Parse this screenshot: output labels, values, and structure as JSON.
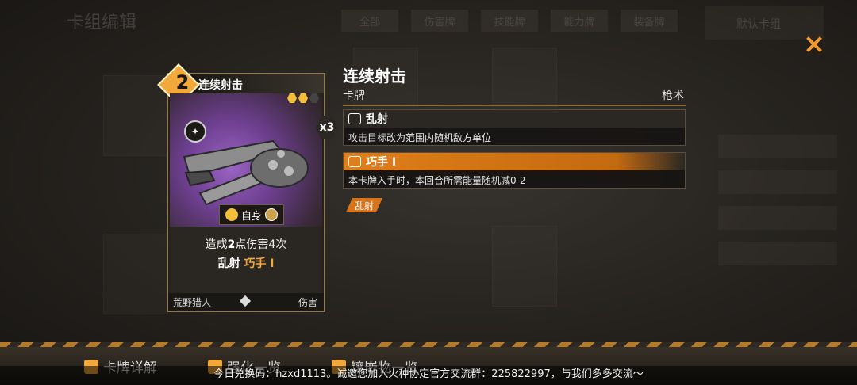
{
  "background": {
    "title": "卡组编辑",
    "tabs": [
      "全部",
      "伤害牌",
      "技能牌",
      "能力牌",
      "装备牌"
    ],
    "default_deck": "默认卡组"
  },
  "card": {
    "cost": "2",
    "name": "连续射击",
    "count": "x3",
    "target": "自身",
    "desc_prefix": "造成",
    "desc_value": "2",
    "desc_suffix": "点伤害4次",
    "keyword1": "乱射",
    "keyword2": "巧手 I",
    "owner": "荒野猎人",
    "kind": "伤害"
  },
  "detail": {
    "title": "连续射击",
    "type": "卡牌",
    "category": "枪术",
    "keywords": [
      {
        "label": "乱射",
        "text": "攻击目标改为范围内随机敌方单位",
        "style": "dark"
      },
      {
        "label": "巧手 I",
        "text": "本卡牌入手时，本回合所需能量随机减0-2",
        "style": "orange"
      }
    ],
    "tag": "乱射"
  },
  "bottom": {
    "buttons": [
      "卡牌详解",
      "强化一览",
      "镶嵌物一览"
    ]
  },
  "ticker": "今日兑换码：hzxd1113。诚邀您加入火种协定官方交流群：225822997，与我们多多交流～",
  "colors": {
    "accent": "#f2a93b",
    "orange_bar": "#e07f1a"
  }
}
